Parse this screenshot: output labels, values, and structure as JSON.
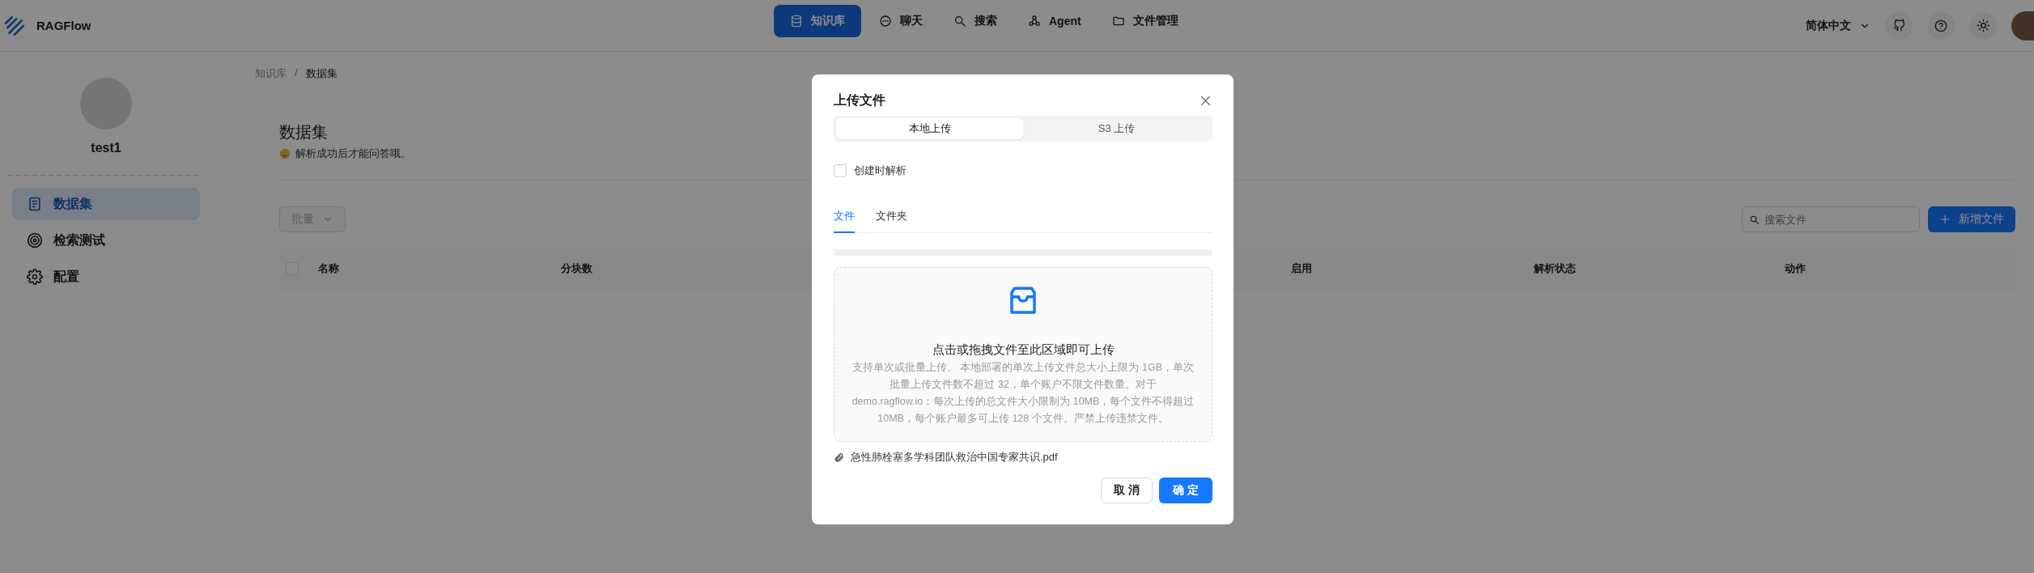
{
  "app": {
    "name": "RAGFlow"
  },
  "nav": [
    {
      "label": "知识库",
      "kind": "database",
      "selected": true
    },
    {
      "label": "聊天",
      "kind": "chat",
      "selected": false
    },
    {
      "label": "搜索",
      "kind": "search",
      "selected": false
    },
    {
      "label": "Agent",
      "kind": "agent",
      "selected": false
    },
    {
      "label": "文件管理",
      "kind": "folder",
      "selected": false
    }
  ],
  "language": {
    "label": "简体中文"
  },
  "sidebar": {
    "user_name": "test1",
    "items": [
      {
        "label": "数据集",
        "kind": "document",
        "selected": true
      },
      {
        "label": "检索测试",
        "kind": "target",
        "selected": false
      },
      {
        "label": "配置",
        "kind": "gear",
        "selected": false
      }
    ]
  },
  "breadcrumb": [
    "知识库",
    "数据集"
  ],
  "breadcrumb_separator": "/",
  "page": {
    "title": "数据集",
    "subtitle": "解析成功后才能问答哦。"
  },
  "toolbar": {
    "bulk": "批量",
    "search": {
      "placeholder": "搜索文件"
    },
    "add": "新增文件"
  },
  "table": {
    "select_all": {
      "checked": false
    },
    "columns": [
      {
        "label": "名称"
      },
      {
        "label": "分块数"
      },
      {
        "label": "启用"
      },
      {
        "label": "解析状态"
      },
      {
        "label": "动作"
      }
    ]
  },
  "modal": {
    "title": "上传文件",
    "source_tabs": [
      {
        "label": "本地上传",
        "selected": true
      },
      {
        "label": "S3 上传",
        "selected": false
      }
    ],
    "parse_on_create": {
      "label": "创建时解析",
      "checked": false
    },
    "type_tabs": [
      {
        "label": "文件",
        "selected": true
      },
      {
        "label": "文件夹",
        "selected": false
      }
    ],
    "progress": {
      "level": 0
    },
    "dropzone": {
      "title": "点击或拖拽文件至此区域即可上传",
      "hint": "支持单次或批量上传。 本地部署的单次上传文件总大小上限为 1GB，单次批量上传文件数不超过 32，单个账户不限文件数量。对于 demo.ragflow.io：每次上传的总文件大小限制为 10MB，每个文件不得超过 10MB，每个账户最多可上传 128 个文件。严禁上传违禁文件。"
    },
    "files": [
      {
        "name": "急性肺栓塞多学科团队救治中国专家共识.pdf"
      }
    ],
    "cancel": "取 消",
    "ok": "确 定"
  }
}
